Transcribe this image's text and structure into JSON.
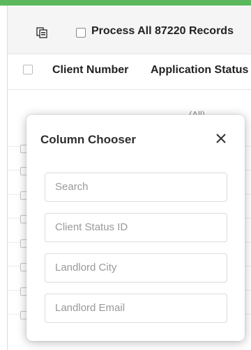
{
  "toolbar": {
    "process_all_label": "Process All 87220 Records",
    "process_all_checked": false,
    "export_icon": "column-chooser-icon"
  },
  "grid": {
    "columns": [
      "Client Number",
      "Application Status"
    ],
    "filter_row": {
      "status_filter_text": "(All)"
    }
  },
  "column_chooser": {
    "title": "Column Chooser",
    "close_icon": "close-icon",
    "search_placeholder": "Search",
    "items": [
      "Client Status ID",
      "Landlord City",
      "Landlord Email"
    ]
  },
  "colors": {
    "accent_bar": "#5cb85c",
    "toolbar_bg": "#f5f5f5"
  }
}
